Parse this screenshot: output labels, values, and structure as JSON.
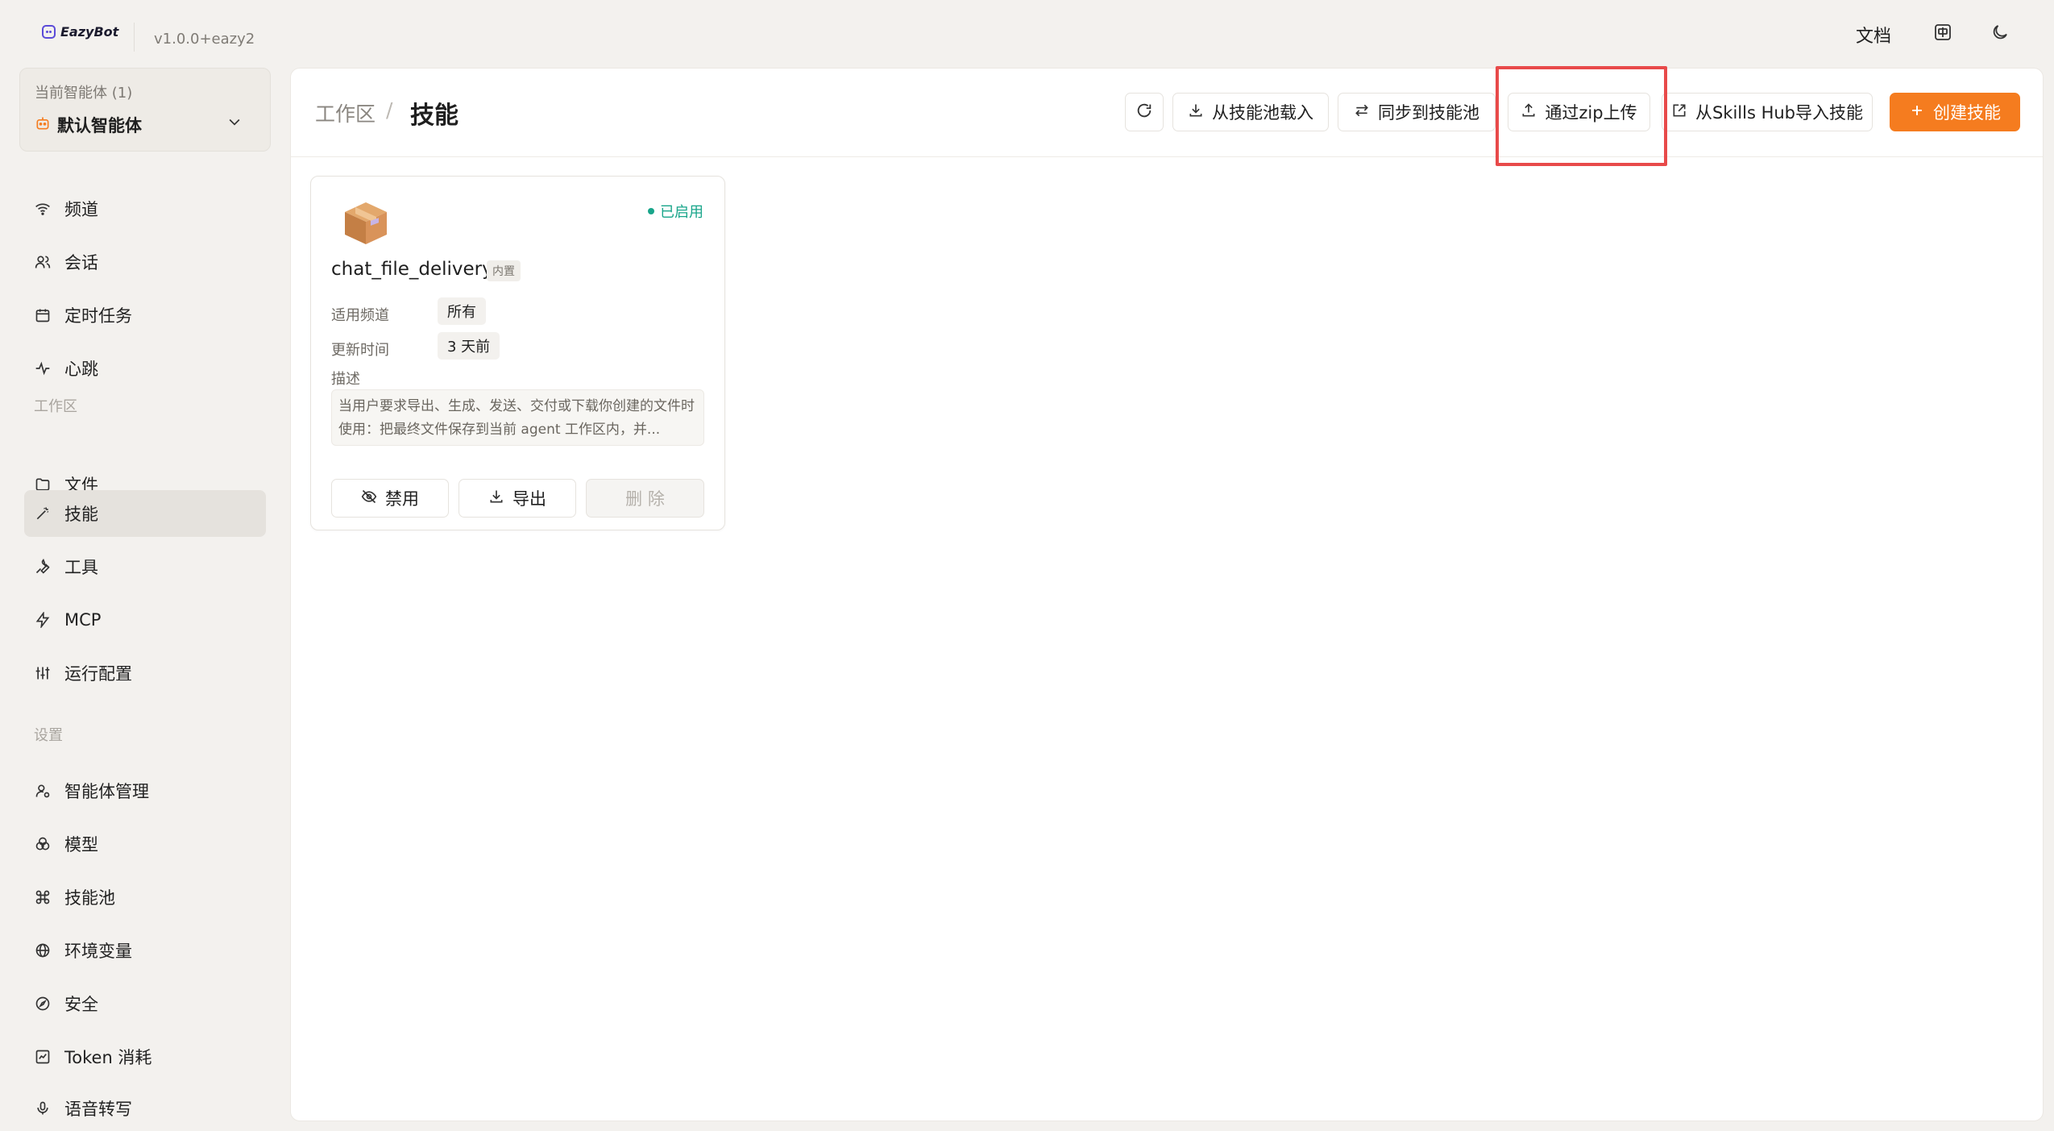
{
  "app": {
    "name": "EazyBot",
    "version": "v1.0.0+eazy2"
  },
  "topbar": {
    "docs_label": "文档",
    "icons": [
      "translate-icon",
      "moon-icon"
    ]
  },
  "agent_selector": {
    "label": "当前智能体 (1)",
    "current": "默认智能体"
  },
  "sidebar": {
    "items_top": [
      {
        "label": "频道",
        "icon": "wifi-icon"
      },
      {
        "label": "会话",
        "icon": "users-icon"
      },
      {
        "label": "定时任务",
        "icon": "calendar-icon"
      },
      {
        "label": "心跳",
        "icon": "pulse-icon"
      }
    ],
    "section_workspace": "工作区",
    "items_workspace": [
      {
        "label": "文件",
        "icon": "folder-icon"
      },
      {
        "label": "技能",
        "icon": "wand-icon",
        "active": true
      },
      {
        "label": "工具",
        "icon": "wrench-icon"
      },
      {
        "label": "MCP",
        "icon": "zap-icon"
      },
      {
        "label": "运行配置",
        "icon": "sliders-icon"
      }
    ],
    "section_settings": "设置",
    "items_settings": [
      {
        "label": "智能体管理",
        "icon": "user-cog-icon"
      },
      {
        "label": "模型",
        "icon": "model-icon"
      },
      {
        "label": "技能池",
        "icon": "command-icon"
      },
      {
        "label": "环境变量",
        "icon": "globe-icon"
      },
      {
        "label": "安全",
        "icon": "compass-icon"
      },
      {
        "label": "Token 消耗",
        "icon": "chart-icon"
      },
      {
        "label": "语音转写",
        "icon": "mic-icon"
      }
    ]
  },
  "breadcrumb": {
    "parent": "工作区",
    "separator": "/",
    "current": "技能"
  },
  "toolbar": {
    "load_from_pool": "从技能池载入",
    "sync_to_pool": "同步到技能池",
    "upload_zip": "通过zip上传",
    "import_hub": "从Skills Hub导入技能",
    "create": "创建技能"
  },
  "skill_card": {
    "icon": "package-box-icon",
    "status": "已启用",
    "name": "chat_file_delivery",
    "tag": "内置",
    "channel_label": "适用频道",
    "channel_value": "所有",
    "updated_label": "更新时间",
    "updated_value": "3 天前",
    "desc_label": "描述",
    "description": "当用户要求导出、生成、发送、交付或下载你创建的文件时使用：把最终文件保存到当前 agent 工作区内，并...",
    "btn_disable": "禁用",
    "btn_export": "导出",
    "btn_delete": "删 除"
  },
  "colors": {
    "accent": "#f57c1f",
    "success": "#18a58a",
    "highlight": "#e84a4a"
  }
}
